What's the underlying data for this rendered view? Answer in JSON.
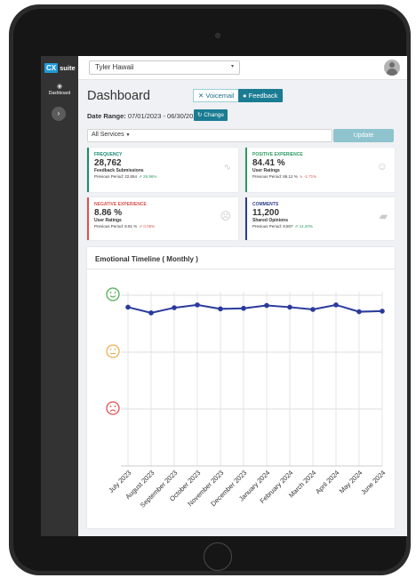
{
  "app": {
    "logo_cx": "CX",
    "logo_suite": "suite"
  },
  "sidebar": {
    "dashboard_label": "Dashboard",
    "toggle_icon": "chevron-right-icon"
  },
  "topbar": {
    "selected_user": "Tyler Hawaii"
  },
  "header": {
    "title": "Dashboard",
    "voicemail_label": "Voicemail",
    "feedback_label": "Feedback",
    "date_range_label": "Date Range:",
    "date_range_value": "07/01/2023 - 06/30/2024",
    "change_label": "Change"
  },
  "filters": {
    "services_value": "All Services",
    "update_label": "Update"
  },
  "cards": [
    {
      "title": "FREQUENCY",
      "value": "28,762",
      "subtitle": "Feedback Submissions",
      "previous": "Previous Period: 22,654",
      "change": "26.96%",
      "icon": "pulse-icon",
      "accent": "#1a8a72",
      "change_color": "#2e9a62"
    },
    {
      "title": "POSITIVE EXPERIENCE",
      "value": "84.41 %",
      "subtitle": "User Ratings",
      "previous": "Previous Period: 86.12 %",
      "change": "-1.71%",
      "icon": "smile-icon",
      "accent": "#2e9a62",
      "change_color": "#d9534f"
    },
    {
      "title": "NEGATIVE EXPERIENCE",
      "value": "8.86 %",
      "subtitle": "User Ratings",
      "previous": "Previous Period: 8.81 %",
      "change": "0.05%",
      "icon": "frown-icon",
      "accent": "#d9534f",
      "change_color": "#d9534f"
    },
    {
      "title": "COMMENTS",
      "value": "11,200",
      "subtitle": "Shared Opinions",
      "previous": "Previous Period: 9,807",
      "change": "14.20%",
      "icon": "comments-icon",
      "accent": "#2d3e8c",
      "change_color": "#2e9a62"
    }
  ],
  "chart_data": {
    "type": "line",
    "title": "Emotional Timeline ( Monthly )",
    "categories": [
      "July 2023",
      "August 2023",
      "September 2023",
      "October 2023",
      "November 2023",
      "December 2023",
      "January 2024",
      "February 2024",
      "March 2024",
      "April 2024",
      "May 2024",
      "June 2024"
    ],
    "y_levels": [
      "positive",
      "neutral",
      "negative"
    ],
    "y_icons": [
      "smile-icon",
      "neutral-face-icon",
      "frown-icon"
    ],
    "ylim": [
      1,
      3
    ],
    "values": [
      2.79,
      2.69,
      2.78,
      2.83,
      2.76,
      2.77,
      2.82,
      2.79,
      2.75,
      2.83,
      2.71,
      2.72
    ],
    "line_color": "#2a3a9c",
    "grid": true
  }
}
